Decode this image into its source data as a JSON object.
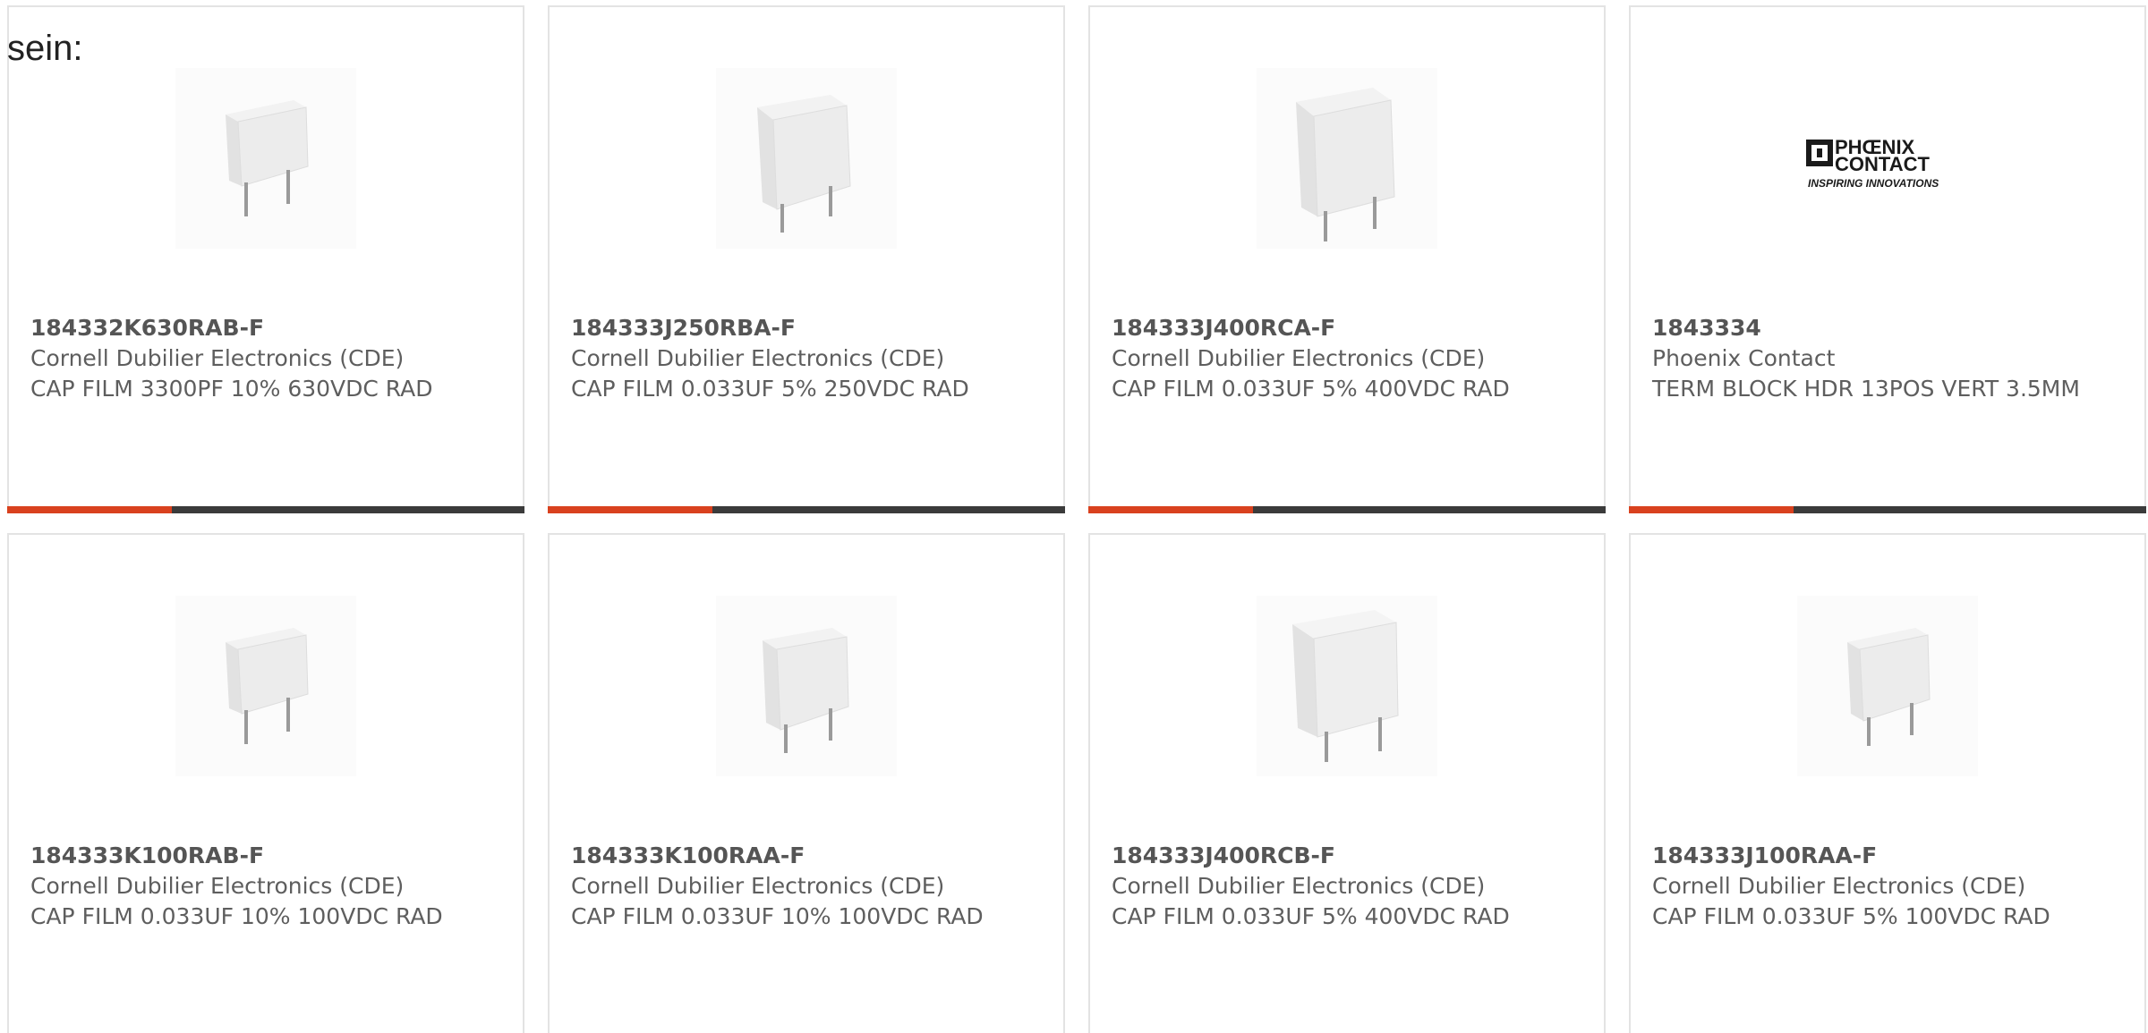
{
  "heading": "sein:",
  "colors": {
    "accent_bar": "#d9411e",
    "dark_bar": "#3b3b3b",
    "card_border": "#e3e3e3"
  },
  "products": [
    {
      "part_number": "184332K630RAB-F",
      "manufacturer": "Cornell Dubilier Electronics (CDE)",
      "description": "CAP FILM 3300PF 10% 630VDC RAD",
      "image": "film-capacitor-icon"
    },
    {
      "part_number": "184333J250RBA-F",
      "manufacturer": "Cornell Dubilier Electronics (CDE)",
      "description": "CAP FILM 0.033UF 5% 250VDC RAD",
      "image": "film-capacitor-icon"
    },
    {
      "part_number": "184333J400RCA-F",
      "manufacturer": "Cornell Dubilier Electronics (CDE)",
      "description": "CAP FILM 0.033UF 5% 400VDC RAD",
      "image": "film-capacitor-icon"
    },
    {
      "part_number": "1843334",
      "manufacturer": "Phoenix Contact",
      "description": "TERM BLOCK HDR 13POS VERT 3.5MM",
      "image": "phoenix-contact-logo",
      "logo_text_line1": "PHŒNIX",
      "logo_text_line2": "CONTACT",
      "logo_tagline": "INSPIRING INNOVATIONS"
    },
    {
      "part_number": "184333K100RAB-F",
      "manufacturer": "Cornell Dubilier Electronics (CDE)",
      "description": "CAP FILM 0.033UF 10% 100VDC RAD",
      "image": "film-capacitor-icon"
    },
    {
      "part_number": "184333K100RAA-F",
      "manufacturer": "Cornell Dubilier Electronics (CDE)",
      "description": "CAP FILM 0.033UF 10% 100VDC RAD",
      "image": "film-capacitor-icon"
    },
    {
      "part_number": "184333J400RCB-F",
      "manufacturer": "Cornell Dubilier Electronics (CDE)",
      "description": "CAP FILM 0.033UF 5% 400VDC RAD",
      "image": "film-capacitor-icon"
    },
    {
      "part_number": "184333J100RAA-F",
      "manufacturer": "Cornell Dubilier Electronics (CDE)",
      "description": "CAP FILM 0.033UF 5% 100VDC RAD",
      "image": "film-capacitor-icon"
    }
  ]
}
